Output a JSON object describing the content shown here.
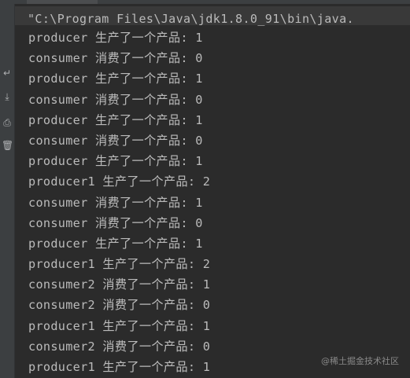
{
  "console": {
    "command": "\"C:\\Program Files\\Java\\jdk1.8.0_91\\bin\\java.",
    "lines": [
      "producer 生产了一个产品: 1",
      "consumer 消费了一个产品: 0",
      "producer 生产了一个产品: 1",
      "consumer 消费了一个产品: 0",
      "producer 生产了一个产品: 1",
      "consumer 消费了一个产品: 0",
      "producer 生产了一个产品: 1",
      "producer1 生产了一个产品: 2",
      "consumer 消费了一个产品: 1",
      "consumer 消费了一个产品: 0",
      "producer 生产了一个产品: 1",
      "producer1 生产了一个产品: 2",
      "consumer2 消费了一个产品: 1",
      "consumer2 消费了一个产品: 0",
      "producer1 生产了一个产品: 1",
      "consumer2 消费了一个产品: 0",
      "producer1 生产了一个产品: 1"
    ]
  },
  "gutter": {
    "icons": [
      "soft-wrap-icon",
      "scroll-to-end-icon",
      "print-icon",
      "clear-icon"
    ]
  },
  "watermark": "@稀土掘金技术社区",
  "colors": {
    "background": "#2b2b2b",
    "gutter": "#3c3f41",
    "text": "#bbbbbb"
  }
}
